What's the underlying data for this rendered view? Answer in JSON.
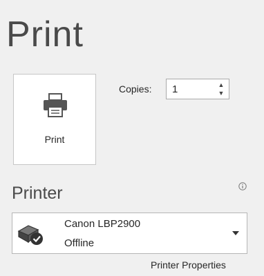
{
  "page": {
    "title": "Print"
  },
  "print_button": {
    "label": "Print",
    "icon": "printer-icon"
  },
  "copies": {
    "label": "Copies:",
    "value": "1"
  },
  "printer_section": {
    "title": "Printer",
    "info_icon": "info-icon",
    "selected_printer": {
      "name": "Canon LBP2900",
      "status": "Offline",
      "icon": "printer-status-icon"
    },
    "properties_link": "Printer Properties"
  }
}
